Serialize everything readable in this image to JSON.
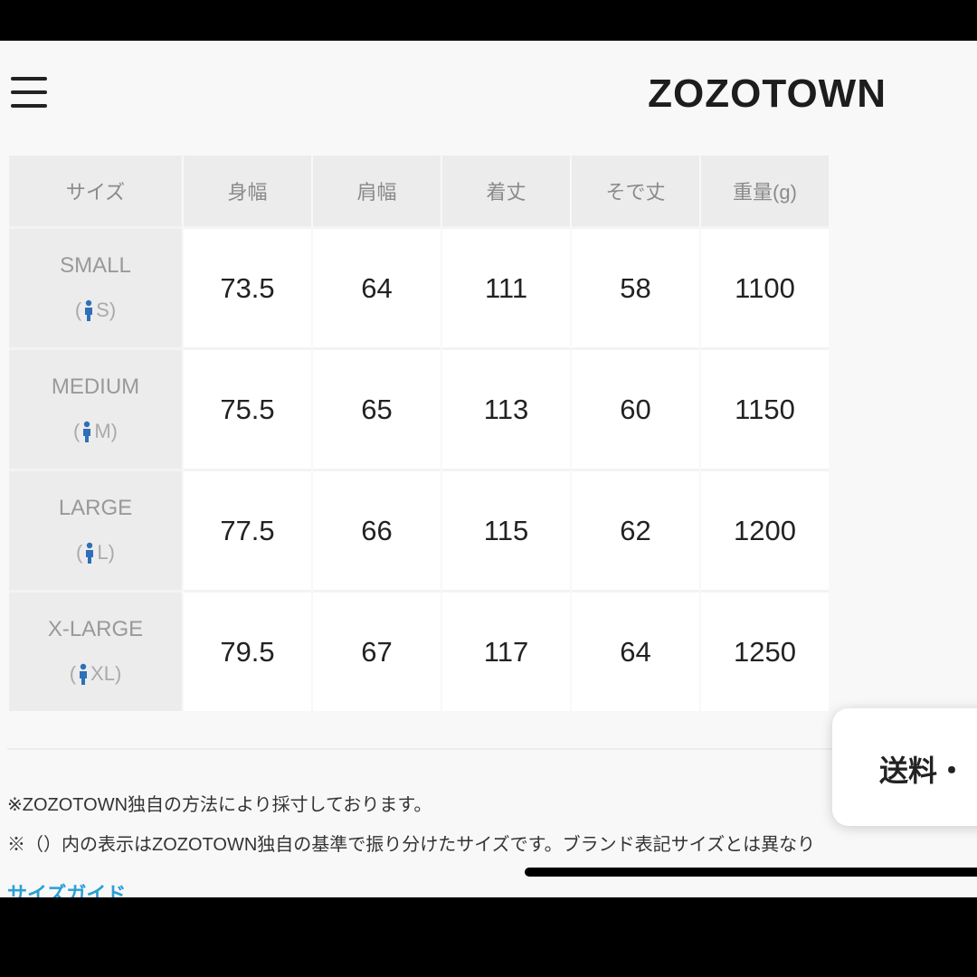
{
  "header": {
    "logo": "ZOZOTOWN",
    "menu_icon": "hamburger-menu-icon"
  },
  "size_table": {
    "headers": [
      "サイズ",
      "身幅",
      "肩幅",
      "着丈",
      "そで丈",
      "重量(g)"
    ],
    "rows": [
      {
        "size": "SMALL",
        "code": "S",
        "values": [
          "73.5",
          "64",
          "111",
          "58",
          "1100"
        ]
      },
      {
        "size": "MEDIUM",
        "code": "M",
        "values": [
          "75.5",
          "65",
          "113",
          "60",
          "1150"
        ]
      },
      {
        "size": "LARGE",
        "code": "L",
        "values": [
          "77.5",
          "66",
          "115",
          "62",
          "1200"
        ]
      },
      {
        "size": "X-LARGE",
        "code": "XL",
        "values": [
          "79.5",
          "67",
          "117",
          "64",
          "1250"
        ]
      }
    ],
    "icon": "person-icon",
    "icon_color": "#2f6fb8"
  },
  "notes": [
    "※ZOZOTOWN独自の方法により採寸しております。",
    "※（）内の表示はZOZOTOWN独自の基準で振り分けたサイズです。ブランド表記サイズとは異なり"
  ],
  "links": {
    "size_guide": "サイズガイド"
  },
  "popup": {
    "shipping": "送料・"
  }
}
